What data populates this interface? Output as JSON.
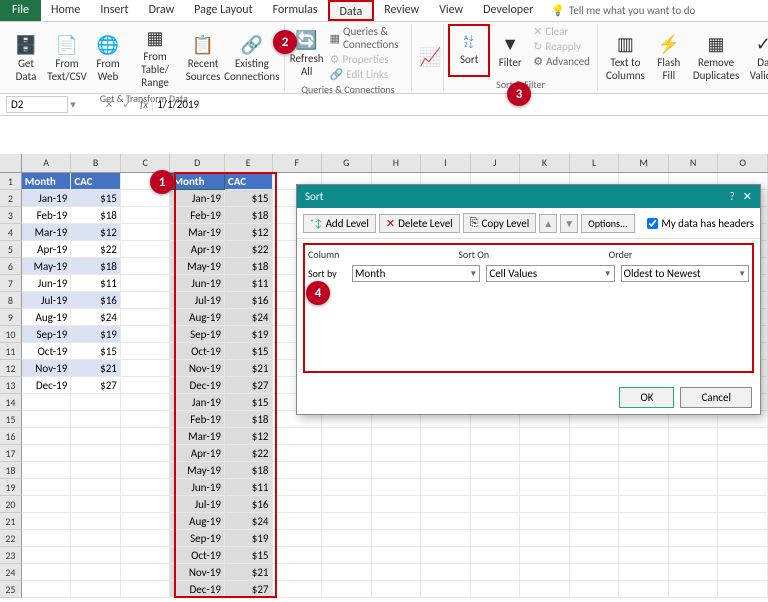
{
  "ribbon": {
    "file": "File",
    "tabs": [
      "Home",
      "Insert",
      "Draw",
      "Page Layout",
      "Formulas",
      "Data",
      "Review",
      "View",
      "Developer"
    ],
    "active_tab": "Data",
    "tell_me": "Tell me what you want to do",
    "groups": {
      "transform": {
        "label": "Get & Transform Data",
        "getdata": "Get\nData",
        "fromcsv": "From\nText/CSV",
        "fromweb": "From\nWeb",
        "fromtable": "From Table/\nRange",
        "recent": "Recent\nSources",
        "existing": "Existing\nConnections"
      },
      "queries": {
        "label": "Queries & Connections",
        "refresh": "Refresh\nAll",
        "qc": "Queries & Connections",
        "props": "Properties",
        "links": "Edit Links"
      },
      "sortfilter": {
        "label": "Sort & Filter",
        "sort": "Sort",
        "filter": "Filter",
        "clear": "Clear",
        "reapply": "Reapply",
        "advanced": "Advanced"
      },
      "datatools": {
        "texttocol": "Text to\nColumns",
        "flash": "Flash\nFill",
        "remove": "Remove\nDuplicates",
        "valida": "Da\nValida"
      }
    }
  },
  "formula_bar": {
    "name": "D2",
    "value": "1/1/2019"
  },
  "columns": [
    "A",
    "B",
    "C",
    "D",
    "E",
    "F",
    "G",
    "H",
    "I",
    "J",
    "K",
    "L",
    "M",
    "N",
    "O"
  ],
  "table1": {
    "headers": [
      "Month",
      "CAC"
    ],
    "rows": [
      [
        "Jan-19",
        "$15"
      ],
      [
        "Feb-19",
        "$18"
      ],
      [
        "Mar-19",
        "$12"
      ],
      [
        "Apr-19",
        "$22"
      ],
      [
        "May-19",
        "$18"
      ],
      [
        "Jun-19",
        "$11"
      ],
      [
        "Jul-19",
        "$16"
      ],
      [
        "Aug-19",
        "$24"
      ],
      [
        "Sep-19",
        "$19"
      ],
      [
        "Oct-19",
        "$15"
      ],
      [
        "Nov-19",
        "$21"
      ],
      [
        "Dec-19",
        "$27"
      ]
    ]
  },
  "table2": {
    "headers": [
      "Month",
      "CAC"
    ],
    "rows": [
      [
        "Jan-19",
        "$15"
      ],
      [
        "Feb-19",
        "$18"
      ],
      [
        "Mar-19",
        "$12"
      ],
      [
        "Apr-19",
        "$22"
      ],
      [
        "May-19",
        "$18"
      ],
      [
        "Jun-19",
        "$11"
      ],
      [
        "Jul-19",
        "$16"
      ],
      [
        "Aug-19",
        "$24"
      ],
      [
        "Sep-19",
        "$19"
      ],
      [
        "Oct-19",
        "$15"
      ],
      [
        "Nov-19",
        "$21"
      ],
      [
        "Dec-19",
        "$27"
      ],
      [
        "Jan-19",
        "$15"
      ],
      [
        "Feb-19",
        "$18"
      ],
      [
        "Mar-19",
        "$12"
      ],
      [
        "Apr-19",
        "$22"
      ],
      [
        "May-19",
        "$18"
      ],
      [
        "Jun-19",
        "$11"
      ],
      [
        "Jul-19",
        "$16"
      ],
      [
        "Aug-19",
        "$24"
      ],
      [
        "Sep-19",
        "$19"
      ],
      [
        "Oct-19",
        "$15"
      ],
      [
        "Nov-19",
        "$21"
      ],
      [
        "Dec-19",
        "$27"
      ]
    ]
  },
  "dialog": {
    "title": "Sort",
    "add": "Add Level",
    "del": "Delete Level",
    "copy": "Copy Level",
    "options": "Options...",
    "headers": "My data has headers",
    "column_h": "Column",
    "sorton_h": "Sort On",
    "order_h": "Order",
    "sortby": "Sort by",
    "col_val": "Month",
    "sorton_val": "Cell Values",
    "order_val": "Oldest to Newest",
    "ok": "OK",
    "cancel": "Cancel"
  },
  "annotations": [
    "1",
    "2",
    "3",
    "4"
  ]
}
